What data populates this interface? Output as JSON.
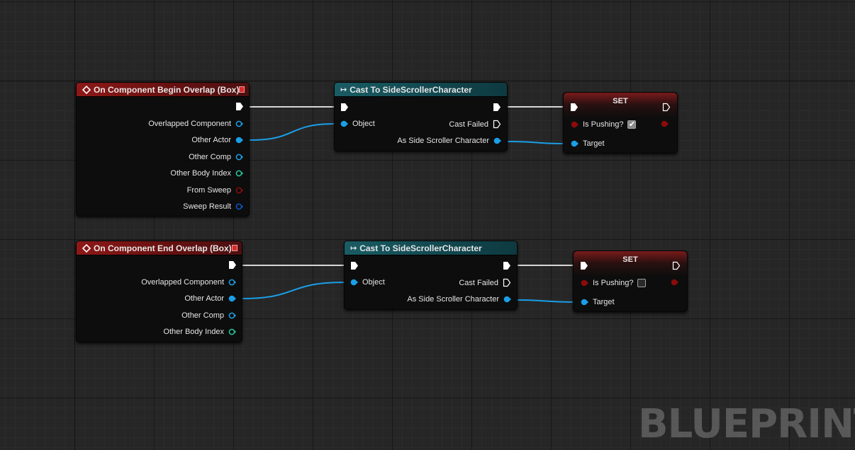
{
  "graph": {
    "watermark": "BLUEPRINT"
  },
  "pin_types": {
    "exec": "#ffffff",
    "object": "#1a9fe8",
    "struct": "#0a56c8",
    "int": "#27c49a",
    "bool": "#8b0b0b"
  },
  "nodes": {
    "begin_overlap": {
      "title": "On Component Begin Overlap (Box)",
      "pins": [
        "Overlapped Component",
        "Other Actor",
        "Other Comp",
        "Other Body Index",
        "From Sweep",
        "Sweep Result"
      ]
    },
    "cast_1": {
      "title": "Cast To SideScrollerCharacter",
      "object_label": "Object",
      "cast_failed_label": "Cast Failed",
      "as_label": "As Side Scroller Character"
    },
    "set_1": {
      "title": "SET",
      "var_label": "Is Pushing?",
      "checked": true,
      "target_label": "Target"
    },
    "end_overlap": {
      "title": "On Component End Overlap (Box)",
      "pins": [
        "Overlapped Component",
        "Other Actor",
        "Other Comp",
        "Other Body Index"
      ]
    },
    "cast_2": {
      "title": "Cast To SideScrollerCharacter",
      "object_label": "Object",
      "cast_failed_label": "Cast Failed",
      "as_label": "As Side Scroller Character"
    },
    "set_2": {
      "title": "SET",
      "var_label": "Is Pushing?",
      "checked": false,
      "target_label": "Target"
    }
  }
}
